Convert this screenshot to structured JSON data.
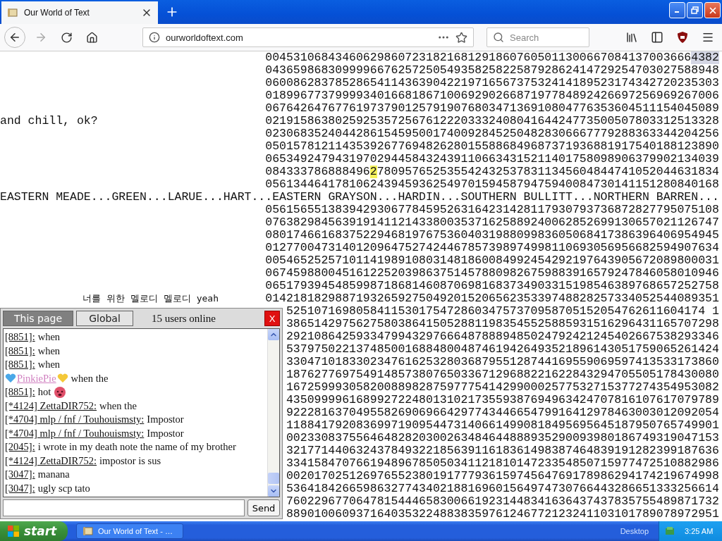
{
  "browser": {
    "tab": {
      "title": "Our World of Text"
    },
    "url": "ourworldoftext.com",
    "search": {
      "placeholder": "Search"
    }
  },
  "page": {
    "rows": [
      {
        "kind": "digits",
        "covered": false,
        "segments": [
          {
            "text": "0045310684346062986072318216812918607605011300667084137003666"
          },
          {
            "text": "4382",
            "color": "#d4d6e4"
          }
        ]
      },
      {
        "kind": "digits",
        "covered": false,
        "segments": [
          {
            "text": "04365986830999966762572505493582582258792862414729254703027588948"
          }
        ]
      },
      {
        "kind": "digits",
        "covered": false,
        "segments": [
          {
            "text": "06008628378528654114363904221971656737532414189523174342720235303"
          }
        ]
      },
      {
        "kind": "digits",
        "covered": false,
        "segments": [
          {
            "text": "01899677379999340166818671006929026687197784892426697256969267006"
          }
        ]
      },
      {
        "kind": "digits",
        "covered": false,
        "segments": [
          {
            "text": "06764264767761973790125791907680347136910804776353604511154045089"
          }
        ]
      },
      {
        "kind": "digits",
        "covered": false,
        "left": {
          "text": "and chill, ok?",
          "kind": "start"
        },
        "segments": [
          {
            "text": "02191586380259253572567612220333240804164424773500507803312513328"
          }
        ]
      },
      {
        "kind": "digits",
        "covered": false,
        "segments": [
          {
            "text": "02306835240442861545950017400928452504828306667779288363344204256"
          }
        ]
      },
      {
        "kind": "digits",
        "covered": false,
        "segments": [
          {
            "text": "05015781211435392677694826280155886849687371936881917540188123890"
          }
        ]
      },
      {
        "kind": "digits",
        "covered": false,
        "segments": [
          {
            "text": "06534924794319702944584324391106634315211401758098906379902134039"
          }
        ]
      },
      {
        "kind": "digits",
        "covered": false,
        "segments": [
          {
            "text": "084333786888496"
          },
          {
            "text": "2",
            "color": "#f4f25a"
          },
          {
            "text": "7809576525355424325378311345604844741052044631834"
          }
        ]
      },
      {
        "kind": "digits",
        "covered": false,
        "segments": [
          {
            "text": "05613446417810624394593625497015945879475940084730141151280840168"
          }
        ]
      },
      {
        "kind": "banner",
        "text": "EASTERN MEADE...GREEN...LARUE...HART...EASTERN GRAYSON...HARDIN...SOUTHERN BULLITT...NORTHERN BARREN..."
      },
      {
        "kind": "digits",
        "covered": false,
        "segments": [
          {
            "text": "05615655138394293067784595263164231428117930793736872827795075108"
          }
        ]
      },
      {
        "kind": "digits",
        "covered": false,
        "segments": [
          {
            "text": "07638298456391914112143380035371625889240062852699130657021126747"
          }
        ]
      },
      {
        "kind": "digits",
        "covered": false,
        "segments": [
          {
            "text": "08017466168375229468197675360403198809983605068417386396406954945"
          }
        ]
      },
      {
        "kind": "digits",
        "covered": false,
        "segments": [
          {
            "text": "01277004731401209647527424467857398974998110693056956682594907634"
          }
        ]
      },
      {
        "kind": "digits",
        "covered": false,
        "segments": [
          {
            "text": "00546525257101141989108031481860084992454292197643905672089800031"
          }
        ]
      },
      {
        "kind": "digits",
        "covered": false,
        "segments": [
          {
            "text": "06745988004516122520398637514578809826759883916579247846058010946"
          }
        ]
      },
      {
        "kind": "digits",
        "covered": false,
        "segments": [
          {
            "text": "06517939454859987186814608706981683734903315198546389768657252758"
          }
        ]
      },
      {
        "kind": "digits",
        "covered": false,
        "left": {
          "text": "너를 위한 멜로디 멜로디 yeah",
          "kind": "indent"
        },
        "segments": [
          {
            "text": "01421818298871932659275049201520656235339748828257334052544089351"
          }
        ]
      },
      {
        "kind": "digits",
        "covered": true,
        "segments": [
          {
            "text": "525107169805841153017547286034757370958705152054762611604174 1"
          }
        ]
      },
      {
        "kind": "digits",
        "covered": true,
        "segments": [
          {
            "text": "38651429756275803864150528811983545525885931516296431165707298"
          }
        ]
      },
      {
        "kind": "digits",
        "covered": true,
        "segments": [
          {
            "text": "29210864259334799432976664878889485024792421245402667538293346"
          }
        ]
      },
      {
        "kind": "digits",
        "covered": true,
        "segments": [
          {
            "text": "53797502213748500168848004874619426493521896143051759065261424"
          }
        ]
      },
      {
        "kind": "digits",
        "covered": true,
        "segments": [
          {
            "text": "33047101833023476162532803687955128744169559069597413533173860"
          }
        ]
      },
      {
        "kind": "digits",
        "covered": true,
        "segments": [
          {
            "text": "18762776975491485738076503367129688221622843294705505178430080"
          }
        ]
      },
      {
        "kind": "digits",
        "covered": true,
        "segments": [
          {
            "text": "16725999305820088982875977754142990002577532715377274354953082"
          }
        ]
      },
      {
        "kind": "digits",
        "covered": true,
        "segments": [
          {
            "text": "43509999616899272248013102173559387694963424707816107617079789"
          }
        ]
      },
      {
        "kind": "digits",
        "covered": true,
        "segments": [
          {
            "text": "92228163704955826906966429774344665479916412978463003012092054"
          }
        ]
      },
      {
        "kind": "digits",
        "covered": true,
        "segments": [
          {
            "text": "11884179208369971909544731406614990818495695645187950765749901"
          }
        ]
      },
      {
        "kind": "digits",
        "covered": true,
        "segments": [
          {
            "text": "00233083755646482820300263484644888935290093980186749319047153"
          }
        ]
      },
      {
        "kind": "digits",
        "covered": true,
        "segments": [
          {
            "text": "32177144063243784932218563911618361498387464839191282399187636"
          }
        ]
      },
      {
        "kind": "digits",
        "covered": true,
        "segments": [
          {
            "text": "33415847076619489678505034112181014723354850715977472510882986"
          }
        ]
      },
      {
        "kind": "digits",
        "covered": true,
        "segments": [
          {
            "text": "00201702512697655238019177793615974564769178986294174219674998"
          }
        ]
      },
      {
        "kind": "digits",
        "covered": true,
        "segments": [
          {
            "text": "53641842665986327743402188169601564974730766443286651333256614"
          }
        ]
      },
      {
        "kind": "digits",
        "covered": true,
        "segments": [
          {
            "text": "76022967706478154446583006619231448341636437437835755489871732"
          }
        ]
      },
      {
        "kind": "digits",
        "covered": true,
        "segments": [
          {
            "text": "88901006093716403532248838359761246772123241103101789078972951"
          }
        ]
      }
    ]
  },
  "chat": {
    "tabs": [
      {
        "label": "This page",
        "selected": true
      },
      {
        "label": "Global",
        "selected": false
      }
    ],
    "online": "15 users online",
    "close": "X",
    "messages": [
      {
        "kind": "plain",
        "user": "[8851]:",
        "text": "when"
      },
      {
        "kind": "plain",
        "user": "[8851]:",
        "text": "when"
      },
      {
        "kind": "plain",
        "user": "[8851]:",
        "text": "when"
      },
      {
        "kind": "hearts",
        "user": "PinkiePie",
        "text": "when the"
      },
      {
        "kind": "face",
        "user": "[8851]:",
        "text": "hot"
      },
      {
        "kind": "plain",
        "user": "[*4124] ZettaDIR752:",
        "text": "when the"
      },
      {
        "kind": "plain",
        "user": "[*4704] mlp / fnf / Touhouismsty:",
        "text": "Impostor"
      },
      {
        "kind": "plain",
        "user": "[*4704] mlp / fnf / Touhouismsty:",
        "text": "Impostor"
      },
      {
        "kind": "plain",
        "user": "[2045]:",
        "text": "i wrote in my death note the name of my brother"
      },
      {
        "kind": "plain",
        "user": "[*4124] ZettaDIR752:",
        "text": "impostor is sus"
      },
      {
        "kind": "plain",
        "user": "[3047]:",
        "text": "manana"
      },
      {
        "kind": "plain",
        "user": "[3047]:",
        "text": "ugly scp tato"
      }
    ],
    "send": "Send"
  },
  "taskbar": {
    "start": "start",
    "task": "Our World of Text - …",
    "desktop": "Desktop",
    "clock": "3:25 AM"
  }
}
